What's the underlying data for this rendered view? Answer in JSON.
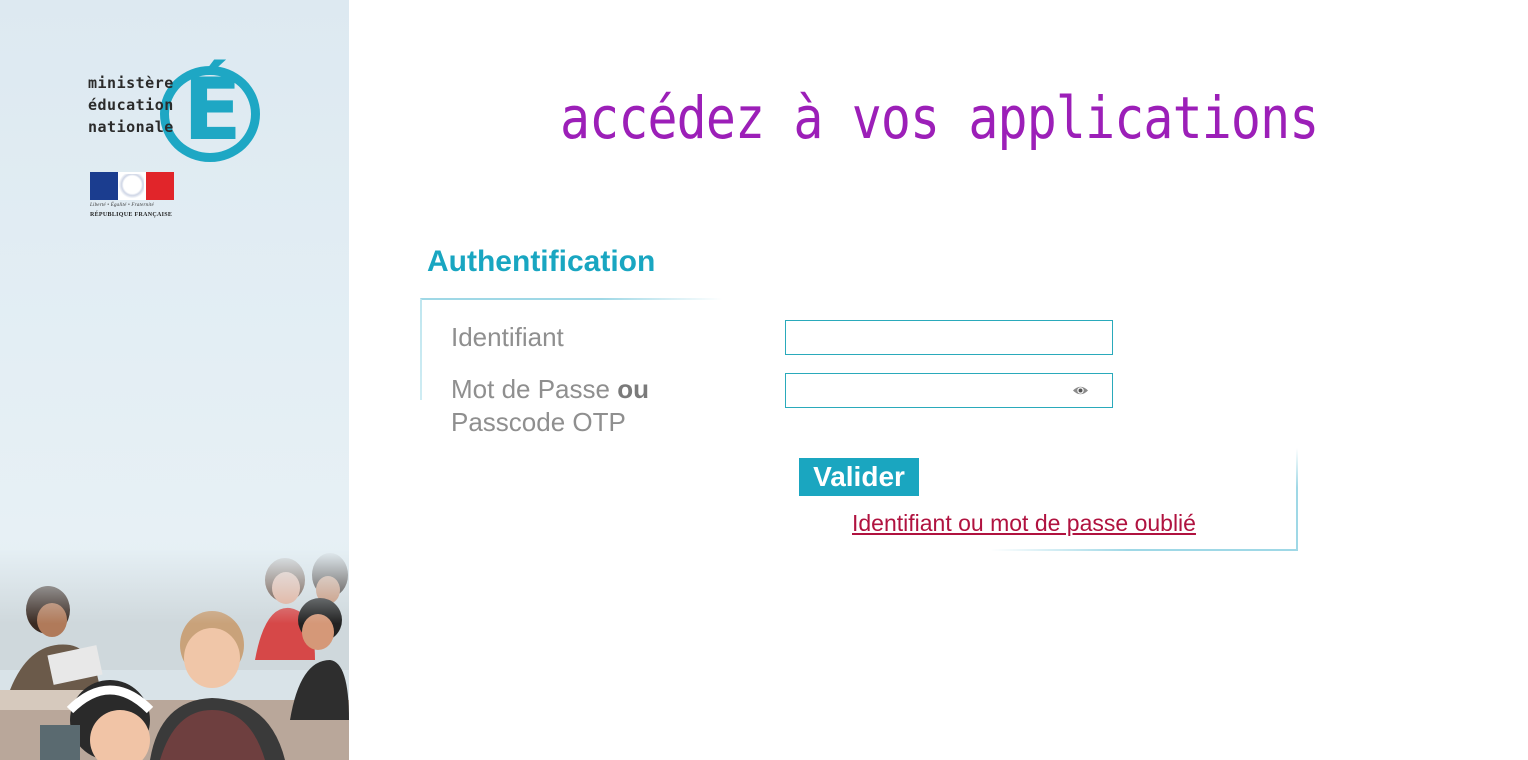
{
  "branding": {
    "ministry_lines": [
      "ministère",
      "éducation",
      "nationale"
    ],
    "logo_letter": "É",
    "republic_motto": "Liberté • Égalité • Fraternité",
    "republic_name": "RÉPUBLIQUE FRANÇAISE"
  },
  "main": {
    "headline": "accédez à vos applications",
    "section_title": "Authentification"
  },
  "form": {
    "login_label": "Identifiant",
    "login_value": "",
    "password_label_part1": "Mot de Passe ",
    "password_label_bold": "ou",
    "password_label_part2": "Passcode OTP",
    "password_value": "",
    "submit_label": "Valider",
    "forgot_link": "Identifiant ou mot de passe oublié"
  },
  "icons": {
    "show_password": "eye-icon"
  },
  "colors": {
    "accent": "#19a6c1",
    "headline": "#9c1fb8",
    "link": "#b0123f",
    "sidebar_bg": "#e3eef4"
  }
}
